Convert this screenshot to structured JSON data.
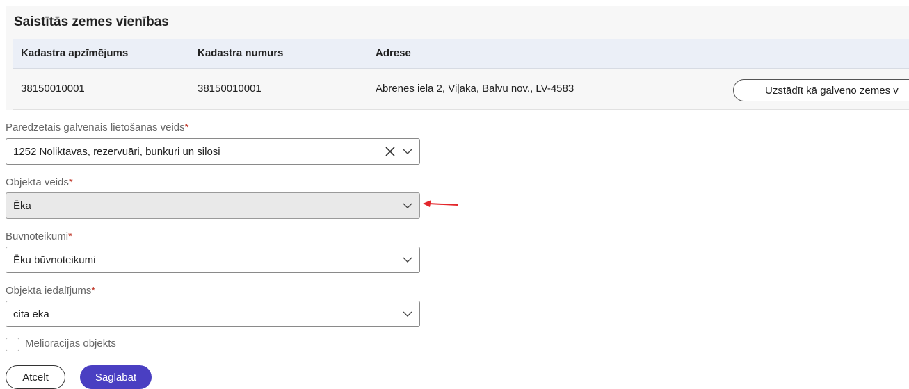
{
  "linked_land_units": {
    "title": "Saistītās zemes vienības",
    "columns": [
      "Kadastra apzīmējums",
      "Kadastra numurs",
      "Adrese"
    ],
    "rows": [
      {
        "designation": "38150010001",
        "number": "38150010001",
        "address": "Abrenes iela 2, Viļaka, Balvu nov., LV-4583",
        "action_label": "Uzstādīt kā galveno zemes v"
      }
    ]
  },
  "form": {
    "usage_type": {
      "label": "Paredzētais galvenais lietošanas veids",
      "required_mark": "*",
      "value": "1252 Noliktavas, rezervuāri, bunkuri un silosi"
    },
    "object_type": {
      "label": "Objekta veids",
      "required_mark": "*",
      "value": "Ēka"
    },
    "building_rules": {
      "label": "Būvnoteikumi",
      "required_mark": "*",
      "value": "Ēku būvnoteikumi"
    },
    "object_division": {
      "label": "Objekta iedalījums",
      "required_mark": "*",
      "value": "cita ēka"
    },
    "melioration": {
      "label": "Meliorācijas objekts",
      "checked": false
    }
  },
  "actions": {
    "cancel_label": "Atcelt",
    "save_label": "Saglabāt"
  },
  "colors": {
    "primary": "#4a3fc2",
    "arrow": "#e3262b",
    "required": "#c0392b",
    "table_header_bg": "#ebeff7",
    "disabled_bg": "#e9e9e9"
  },
  "icons": [
    "clear-icon",
    "chevron-down-icon",
    "annotation-arrow-icon"
  ]
}
